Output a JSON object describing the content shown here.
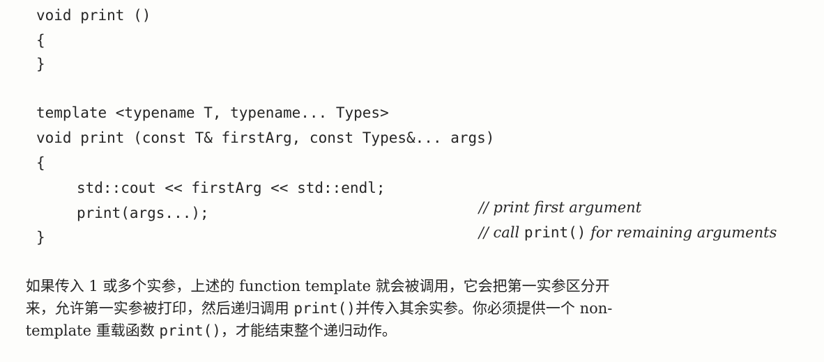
{
  "code": {
    "l1": "void print ()",
    "l2": "{",
    "l3": "}",
    "l4": "template <typename T, typename... Types>",
    "l5": "void print (const T& firstArg, const Types&... args)",
    "l6": "{",
    "l7": "std::cout << firstArg << std::endl;",
    "l8": "print(args...);",
    "l9": "}"
  },
  "comments": {
    "c1": "// print first argument",
    "c2_a": "// call ",
    "c2_code": "print()",
    "c2_b": " for remaining arguments"
  },
  "paragraph": {
    "p1": "如果传入 1 或多个实参，上述的 function template 就会被调用，它会把第一实参区分开",
    "p2_a": "来，允许第一实参被打印，然后递归调用 ",
    "p2_code": "print()",
    "p2_b": "并传入其余实参。你必须提供一个 non-",
    "p3_a": "template 重载函数 ",
    "p3_code": "print()",
    "p3_b": "，才能结束整个递归动作。"
  }
}
